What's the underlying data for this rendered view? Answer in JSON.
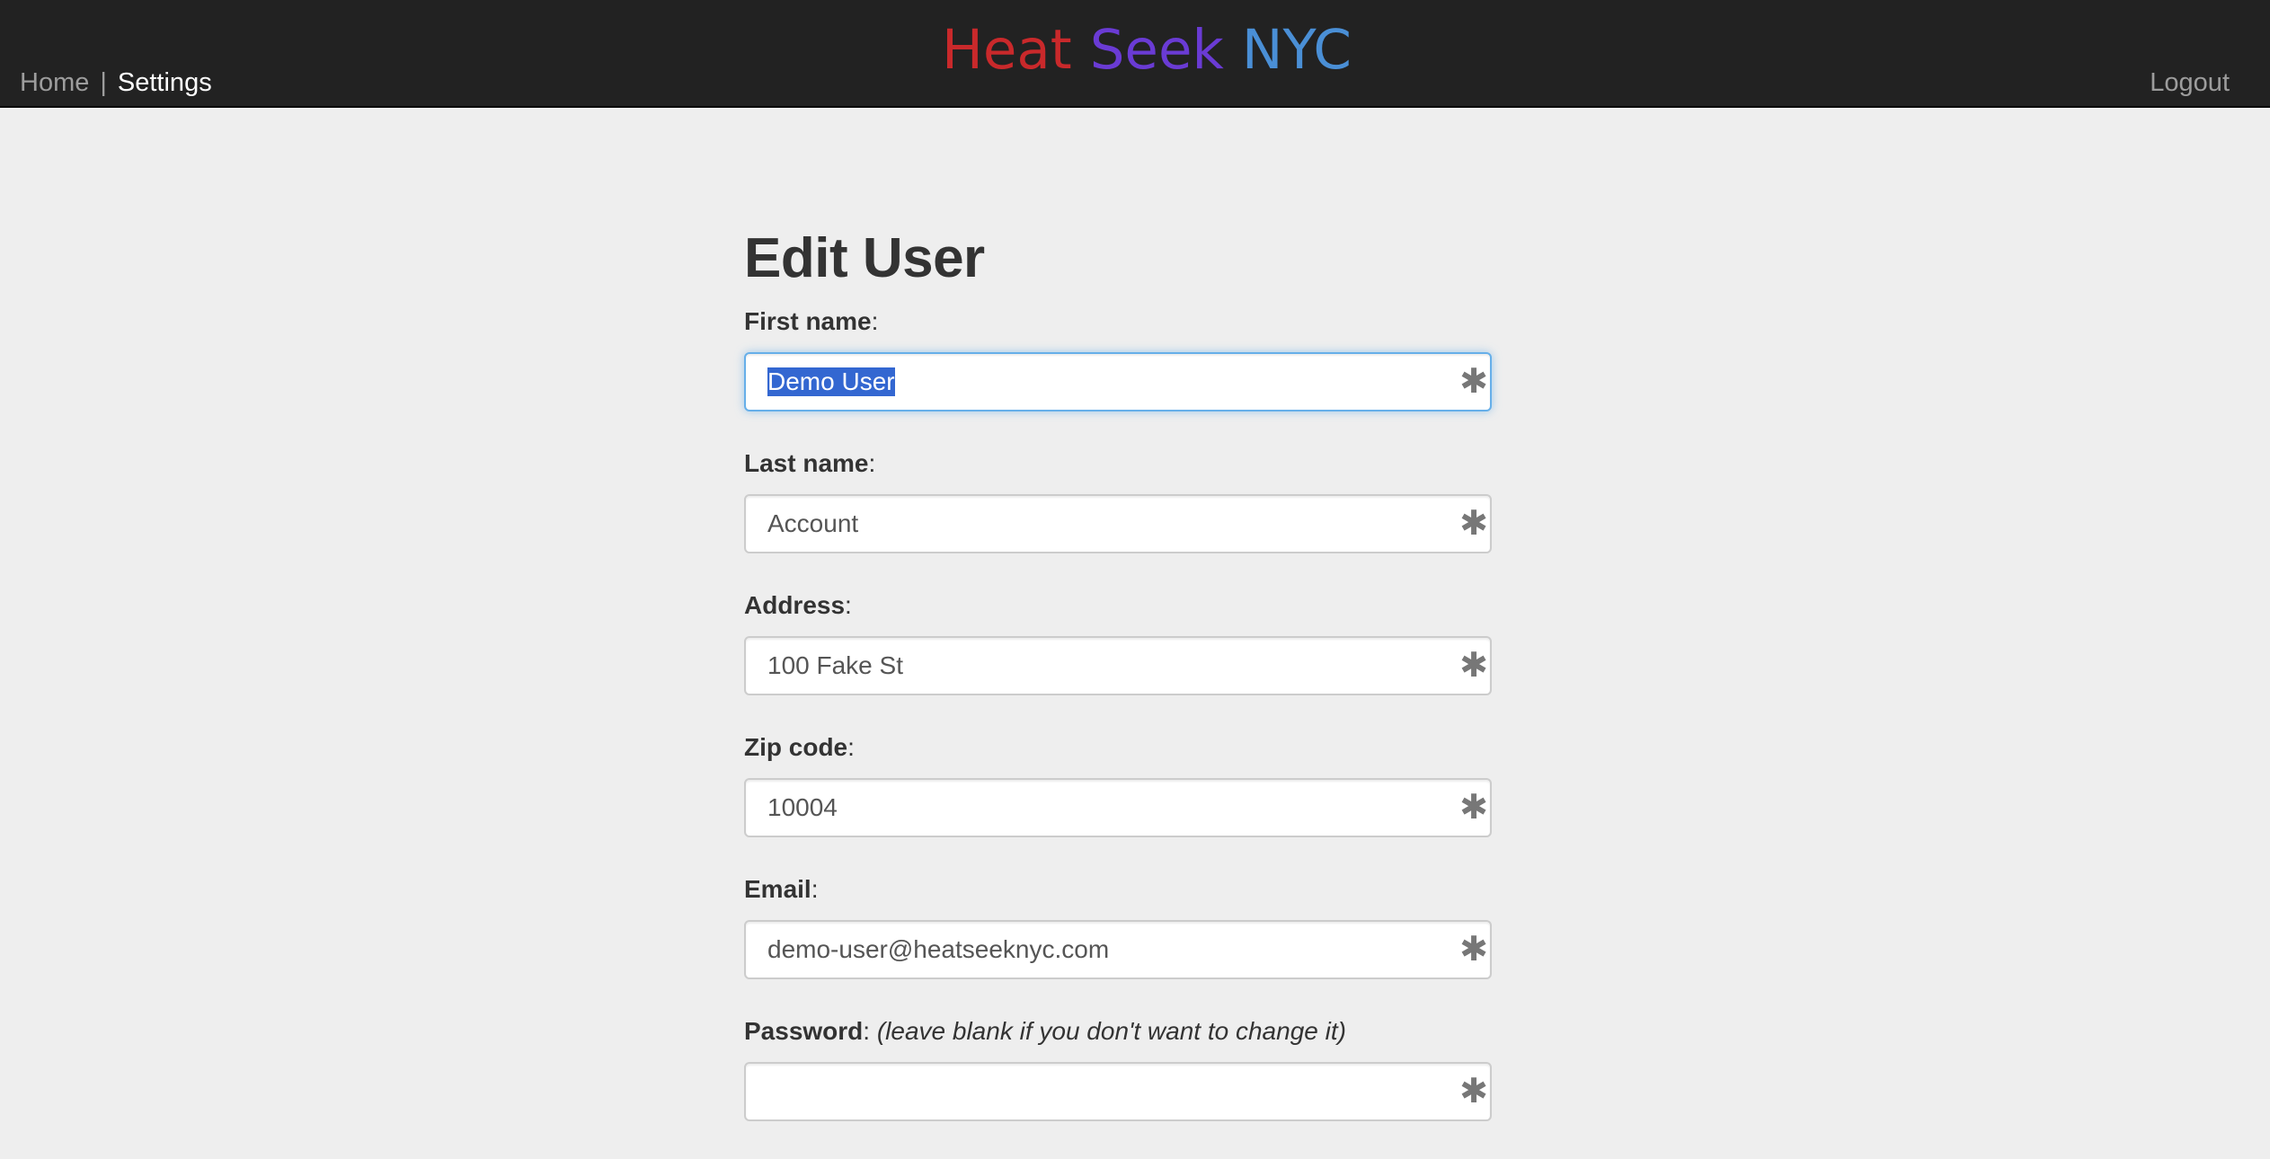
{
  "nav": {
    "home_label": "Home",
    "separator": "|",
    "settings_label": "Settings",
    "logout_label": "Logout"
  },
  "brand": {
    "word1": "Heat",
    "word2": "Seek",
    "word3": "NYC",
    "colors": {
      "heat": "#c9292b",
      "seek": "#6a3bd4",
      "nyc": "#4a8fd6"
    }
  },
  "form": {
    "title": "Edit User",
    "fields": {
      "first_name": {
        "label": "First name",
        "colon": ":",
        "value": "Demo User",
        "required_icon": "asterisk-icon"
      },
      "last_name": {
        "label": "Last name",
        "colon": ":",
        "value": "Account",
        "required_icon": "asterisk-icon"
      },
      "address": {
        "label": "Address",
        "colon": ":",
        "value": "100 Fake St",
        "required_icon": "asterisk-icon"
      },
      "zip_code": {
        "label": "Zip code",
        "colon": ":",
        "value": "10004",
        "required_icon": "asterisk-icon"
      },
      "email": {
        "label": "Email",
        "colon": ":",
        "value": "demo-user@heatseeknyc.com",
        "required_icon": "asterisk-icon"
      },
      "password": {
        "label": "Password",
        "colon": ": ",
        "hint": "(leave blank if you don't want to change it)",
        "value": "",
        "required_icon": "asterisk-icon"
      }
    }
  }
}
